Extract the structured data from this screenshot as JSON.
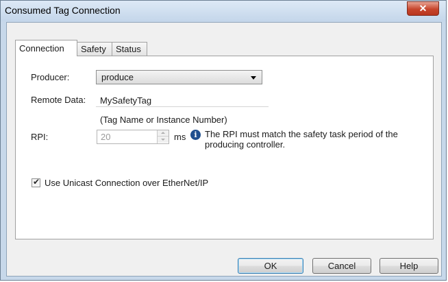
{
  "window": {
    "title": "Consumed Tag Connection"
  },
  "tabs": [
    {
      "label": "Connection"
    },
    {
      "label": "Safety"
    },
    {
      "label": "Status"
    }
  ],
  "form": {
    "producer_label": "Producer:",
    "producer_value": "produce",
    "remote_data_label": "Remote Data:",
    "remote_data_value": "MySafetyTag",
    "remote_data_hint": "(Tag Name or Instance Number)",
    "rpi_label": "RPI:",
    "rpi_value": "20",
    "rpi_unit": "ms",
    "rpi_info": "The RPI must match the safety task period of the producing controller.",
    "unicast_label": "Use Unicast Connection over EtherNet/IP",
    "unicast_checked": true
  },
  "buttons": {
    "ok": "OK",
    "cancel": "Cancel",
    "help": "Help"
  },
  "icons": {
    "close": "close-icon",
    "info": "info-icon",
    "dropdown": "chevron-down-icon"
  },
  "colors": {
    "close_button": "#c7452c",
    "info_icon": "#1f4f8f",
    "default_button_border": "#3c7fb1"
  }
}
